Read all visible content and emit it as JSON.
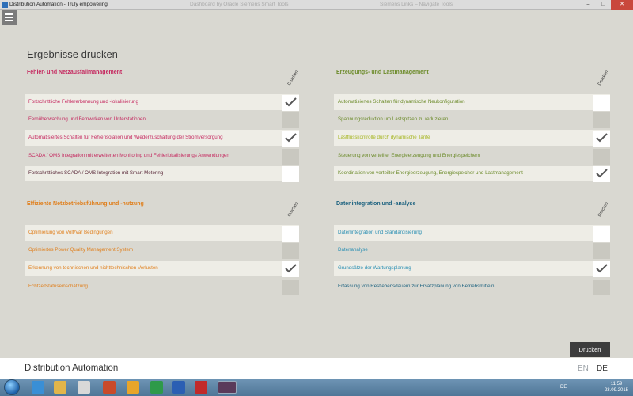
{
  "window": {
    "title": "Distribution Automation - Truly empowering",
    "ghost_titles": [
      "Dashboard by Oracle Siemens Smart Tools",
      "Siemens Links – Navigate Tools"
    ],
    "controls": {
      "minimize": "–",
      "maximize": "□",
      "close": "✕"
    }
  },
  "page": {
    "title": "Ergebnisse drucken"
  },
  "columns": {
    "print_header": "Drucken"
  },
  "colors": {
    "fault": "#c5285f",
    "generation": "#6c8b2a",
    "generation_active": "#a5b51f",
    "operations": "#e07f1c",
    "data": "#2a8fb3",
    "data_dark": "#1e6380"
  },
  "sections": [
    {
      "title": "Fehler- und Netzausfallmanagement",
      "items": [
        {
          "label": "Fortschrittliche Fehlererkennung und -lokalisierung",
          "state": "checked"
        },
        {
          "label": "Fernüberwachung und Fernwirken von Unterstationen",
          "state": "disabled"
        },
        {
          "label": "Automatisiertes Schalten für Fehlerisolation und Wiederzuschaltung der Stromversorgung",
          "state": "checked"
        },
        {
          "label": "SCADA / OMS Integration mit erweiterten Monitoring und Fehlerlokalisierungs Anwendungen",
          "state": "disabled"
        },
        {
          "label": "Fortschrittliches SCADA / OMS Integration mit Smart Metering",
          "state": "unchecked"
        }
      ]
    },
    {
      "title": "Erzeugungs- und Lastmanagement",
      "items": [
        {
          "label": "Automatisiertes Schalten für dynamische Neukonfiguration",
          "state": "unchecked"
        },
        {
          "label": "Spannungsreduktion um Lastspitzen zu reduzieren",
          "state": "disabled"
        },
        {
          "label": "Lastflusskontrolle durch dynamische Tarife",
          "state": "checked"
        },
        {
          "label": "Steuerung von verteilter Energieerzeugung und Energiespeichern",
          "state": "disabled"
        },
        {
          "label": "Koordination von verteilter Energieerzeugung, Energiespeicher und Lastmanagement",
          "state": "checked"
        }
      ]
    },
    {
      "title": "Effiziente Netzbetriebsführung und -nutzung",
      "items": [
        {
          "label": "Optimierung von Volt/Var Bedingungen",
          "state": "unchecked"
        },
        {
          "label": "Optimiertes Power Quality Management System",
          "state": "disabled"
        },
        {
          "label": "Erkennung von technischen und nichttechnischen Verlusten",
          "state": "checked"
        },
        {
          "label": "Echtzeitstatuseinschätzung",
          "state": "disabled"
        }
      ]
    },
    {
      "title": "Datenintegration und -analyse",
      "items": [
        {
          "label": "Datenintegration und Standardisierung",
          "state": "unchecked"
        },
        {
          "label": "Datenanalyse",
          "state": "disabled"
        },
        {
          "label": "Grundsätze der Wartungsplanung",
          "state": "checked"
        },
        {
          "label": "Erfassung von Restlebensdauern zur Ersatzplanung von Betriebsmitteln",
          "state": "disabled"
        }
      ]
    }
  ],
  "actions": {
    "print_label": "Drucken"
  },
  "footer": {
    "brand": "Distribution Automation",
    "lang_en": "EN",
    "lang_de": "DE"
  },
  "taskbar": {
    "lang": "DE",
    "time": "11:59",
    "date": "23.09.2015"
  }
}
